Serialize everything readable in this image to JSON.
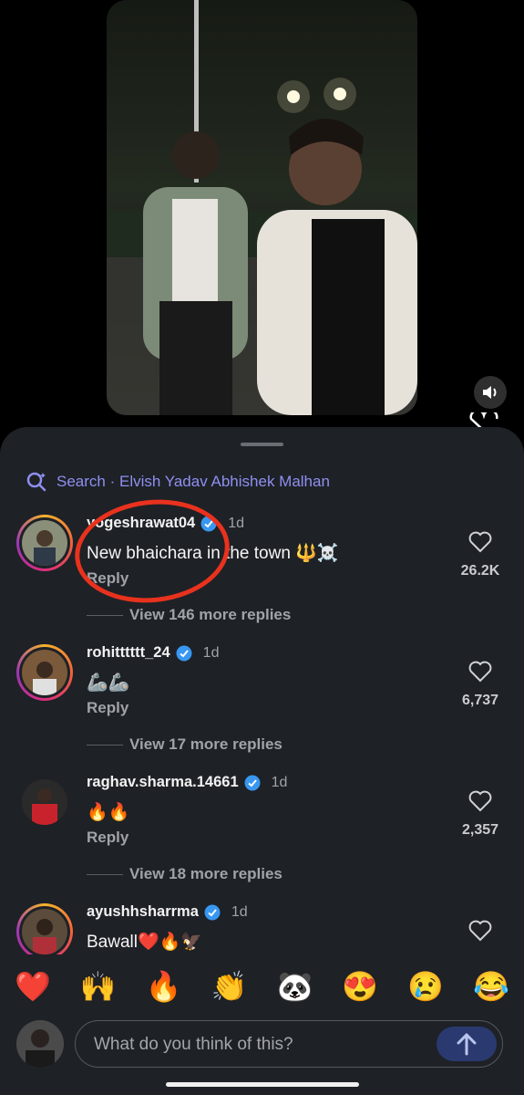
{
  "search": {
    "prefix": "Search",
    "separator": "·",
    "query": "Elvish Yadav Abhishek Malhan"
  },
  "comments": [
    {
      "username": "yogeshrawat04",
      "verified": true,
      "time": "1d",
      "text": "New bhaichara in the town 🔱☠️",
      "reply": "Reply",
      "likes": "26.2K",
      "view_more": "View 146 more replies"
    },
    {
      "username": "rohitttttt_24",
      "verified": true,
      "time": "1d",
      "text": "🦾🦾",
      "reply": "Reply",
      "likes": "6,737",
      "view_more": "View 17 more replies"
    },
    {
      "username": "raghav.sharma.14661",
      "verified": true,
      "time": "1d",
      "text": "🔥🔥",
      "reply": "Reply",
      "likes": "2,357",
      "view_more": "View 18 more replies"
    },
    {
      "username": "ayushhsharrma",
      "verified": true,
      "time": "1d",
      "text": "Bawall❤️🔥🦅",
      "reply": "",
      "likes": "",
      "view_more": ""
    }
  ],
  "emoji_bar": [
    "❤️",
    "🙌",
    "🔥",
    "👏",
    "🐼",
    "😍",
    "😢",
    "😂"
  ],
  "composer": {
    "placeholder": "What do you think of this?"
  },
  "colors": {
    "sheet": "#1e2126",
    "accent": "#8f8ff0",
    "verified": "#3897f0",
    "annotation": "#e8321d"
  }
}
